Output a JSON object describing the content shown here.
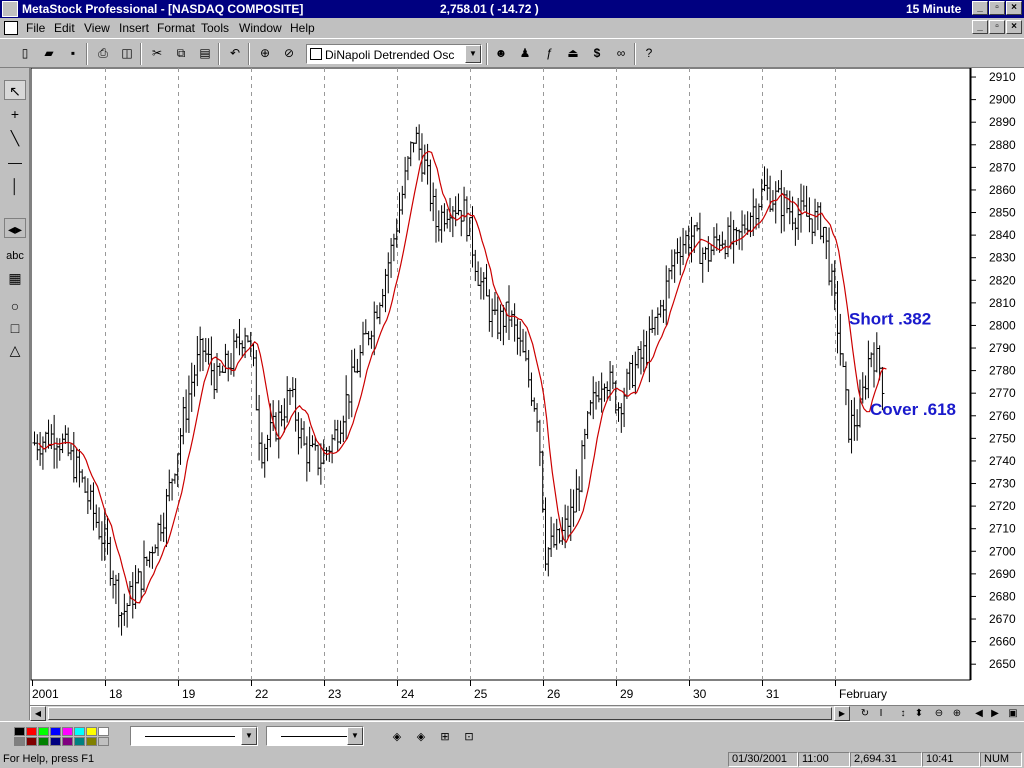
{
  "window": {
    "title": "MetaStock Professional - [NASDAQ  COMPOSITE]",
    "price_readout": "2,758.01 ( -14.72 )",
    "interval": "15 Minute"
  },
  "menu": [
    "File",
    "Edit",
    "View",
    "Insert",
    "Format",
    "Tools",
    "Window",
    "Help"
  ],
  "toolbar": {
    "indicator_select": "DiNapoli Detrended Osc",
    "icons": [
      "new-icon",
      "open-icon",
      "save-icon",
      "print-icon",
      "print-preview-icon",
      "cut-icon",
      "copy-icon",
      "paste-icon",
      "undo-icon",
      "crosshair-icon",
      "zoom-icon",
      "expert-icon",
      "expert-advisor-icon",
      "formula-icon",
      "indicator-builder-icon",
      "dollar-icon",
      "binoculars-icon",
      "help-pointer-icon"
    ]
  },
  "left_tools": [
    "pointer-icon",
    "crosshair-tool-icon",
    "trendline-tool-icon",
    "horizontal-line-tool-icon",
    "vertical-line-tool-icon",
    "scroll-split-icon",
    "text-tool-icon",
    "grid-tool-icon",
    "ellipse-tool-icon",
    "rectangle-tool-icon",
    "triangle-tool-icon"
  ],
  "left_tools_text_label": "abc",
  "chart_data": {
    "type": "line",
    "series": [
      {
        "kind": "ohlc-bars",
        "color": "#000000"
      },
      {
        "kind": "moving-average",
        "color": "#cc0000"
      }
    ],
    "y_ticks": [
      2910,
      2900,
      2890,
      2880,
      2870,
      2860,
      2850,
      2840,
      2830,
      2820,
      2810,
      2800,
      2790,
      2780,
      2770,
      2760,
      2750,
      2740,
      2730,
      2720,
      2710,
      2700,
      2690,
      2680,
      2670,
      2660,
      2650
    ],
    "ylim": [
      2643,
      2914
    ],
    "x_labels": [
      "2001",
      "18",
      "19",
      "22",
      "23",
      "24",
      "25",
      "26",
      "29",
      "30",
      "31",
      "February"
    ],
    "annotations": [
      {
        "text": "Short .382",
        "value": 2803,
        "color": "#1a1acc"
      },
      {
        "text": "Cover .618",
        "value": 2763,
        "color": "#1a1acc"
      }
    ],
    "close_points": [
      [
        0,
        2748
      ],
      [
        0.3,
        2752
      ],
      [
        0.6,
        2735
      ],
      [
        1,
        2700
      ],
      [
        1.2,
        2672
      ],
      [
        1.45,
        2688
      ],
      [
        1.8,
        2720
      ],
      [
        2,
        2752
      ],
      [
        2.15,
        2775
      ],
      [
        2.3,
        2790
      ],
      [
        2.5,
        2775
      ],
      [
        2.7,
        2785
      ],
      [
        2.9,
        2800
      ],
      [
        3.0,
        2780
      ],
      [
        3.1,
        2745
      ],
      [
        3.3,
        2755
      ],
      [
        3.5,
        2770
      ],
      [
        3.7,
        2745
      ],
      [
        3.9,
        2740
      ],
      [
        4.1,
        2750
      ],
      [
        4.3,
        2770
      ],
      [
        4.5,
        2790
      ],
      [
        4.7,
        2810
      ],
      [
        4.9,
        2835
      ],
      [
        5.05,
        2860
      ],
      [
        5.2,
        2885
      ],
      [
        5.35,
        2870
      ],
      [
        5.5,
        2845
      ],
      [
        5.7,
        2855
      ],
      [
        5.9,
        2850
      ],
      [
        6.1,
        2820
      ],
      [
        6.3,
        2800
      ],
      [
        6.5,
        2805
      ],
      [
        6.7,
        2785
      ],
      [
        6.9,
        2760
      ],
      [
        7.0,
        2700
      ],
      [
        7.2,
        2705
      ],
      [
        7.4,
        2720
      ],
      [
        7.6,
        2760
      ],
      [
        7.8,
        2780
      ],
      [
        8.0,
        2765
      ],
      [
        8.2,
        2780
      ],
      [
        8.4,
        2790
      ],
      [
        8.6,
        2810
      ],
      [
        8.8,
        2835
      ],
      [
        9.0,
        2840
      ],
      [
        9.2,
        2830
      ],
      [
        9.4,
        2840
      ],
      [
        9.6,
        2835
      ],
      [
        9.8,
        2850
      ],
      [
        10.0,
        2860
      ],
      [
        10.2,
        2855
      ],
      [
        10.4,
        2850
      ],
      [
        10.6,
        2848
      ],
      [
        10.8,
        2845
      ],
      [
        11.0,
        2800
      ],
      [
        11.15,
        2755
      ],
      [
        11.3,
        2760
      ],
      [
        11.45,
        2790
      ],
      [
        11.6,
        2780
      ],
      [
        11.65,
        2765
      ]
    ]
  },
  "bottom_toolbar": {
    "palette_colors": [
      "#000000",
      "#ff0000",
      "#00ff00",
      "#0000ff",
      "#ff00ff",
      "#00ffff",
      "#ffff00",
      "#ffffff",
      "#808080",
      "#800000",
      "#008000",
      "#000080",
      "#800080",
      "#008080",
      "#808000",
      "#c0c0c0"
    ],
    "icons": [
      "properties-icon",
      "properties2-icon",
      "background-icon",
      "gridlines-icon"
    ]
  },
  "nav_icons": [
    "refresh-icon",
    "cursor-bar-icon",
    "resize-vertical-icon",
    "zoom-out-icon",
    "zoom-in-icon",
    "scroll-left-icon",
    "scroll-right-icon",
    "restore-icon"
  ],
  "status": {
    "help": "For Help, press F1",
    "date": "01/30/2001",
    "time": "11:00",
    "value": "2,694.31",
    "clock": "10:41",
    "num": "NUM"
  }
}
